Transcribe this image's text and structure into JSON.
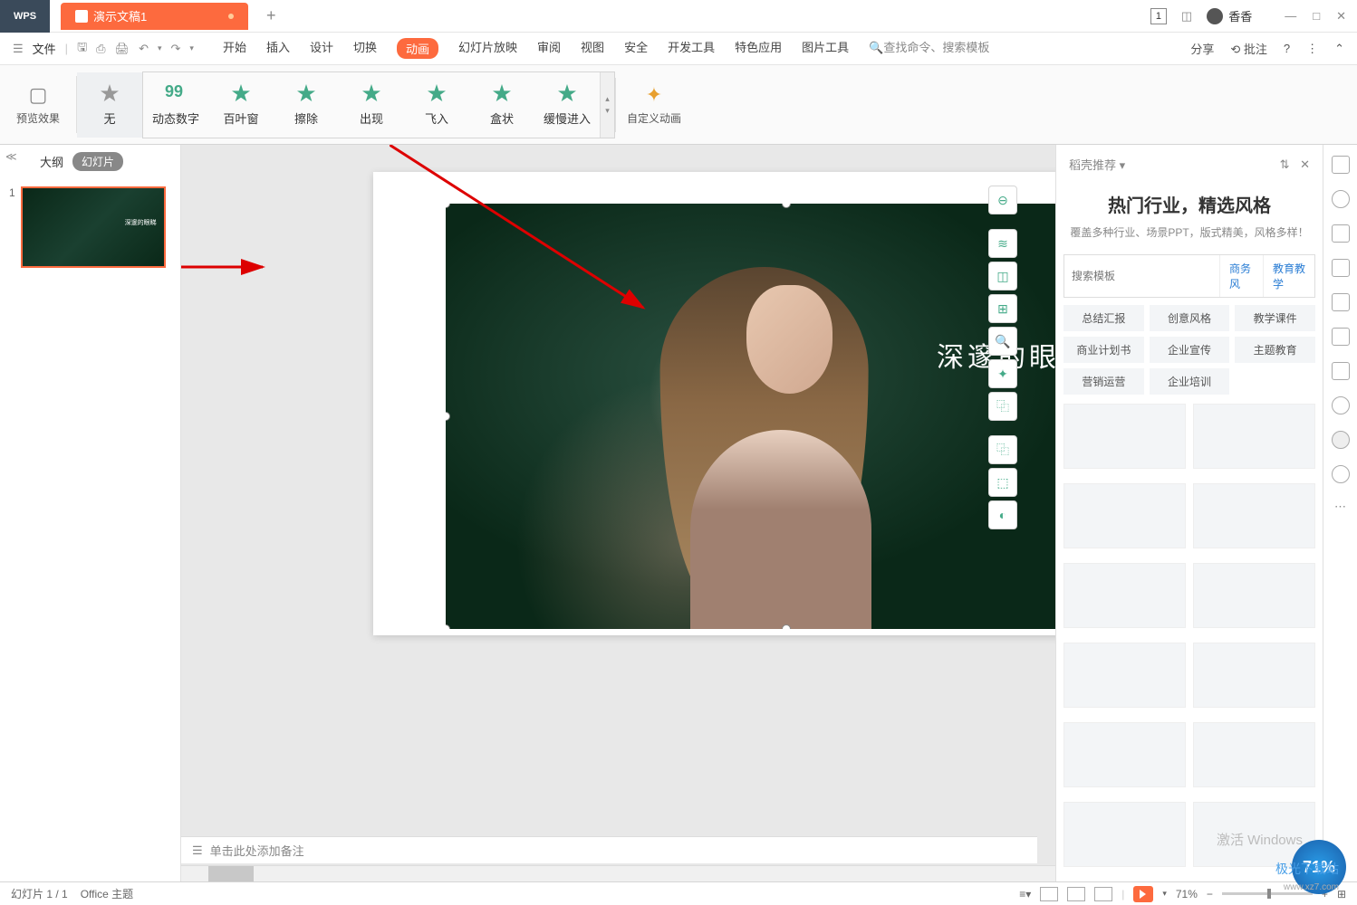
{
  "titlebar": {
    "app": "WPS",
    "tab_name": "演示文稿1",
    "count_box": "1",
    "username": "香香"
  },
  "menu": {
    "file": "文件",
    "tabs": [
      "开始",
      "插入",
      "设计",
      "切换",
      "动画",
      "幻灯片放映",
      "审阅",
      "视图",
      "安全",
      "开发工具",
      "特色应用",
      "图片工具"
    ],
    "search_prompt": "查找命令、搜索模板",
    "share": "分享",
    "batch": "批注"
  },
  "ribbon": {
    "preview": "预览效果",
    "animations": [
      "无",
      "动态数字",
      "百叶窗",
      "擦除",
      "出现",
      "飞入",
      "盒状",
      "缓慢进入"
    ],
    "custom": "自定义动画"
  },
  "thumbs": {
    "outline": "大纲",
    "slides": "幻灯片"
  },
  "slide": {
    "text": "深邃的眼眸"
  },
  "notes": {
    "placeholder": "单击此处添加备注"
  },
  "side": {
    "title": "稻壳推荐",
    "promo_title": "热门行业，精选风格",
    "promo_sub": "覆盖多种行业、场景PPT，版式精美，风格多样！",
    "search_placeholder": "搜索模板",
    "chips": [
      "商务风",
      "教育教学"
    ],
    "tags": [
      "总结汇报",
      "创意风格",
      "教学课件",
      "商业计划书",
      "企业宣传",
      "主题教育",
      "营销运营",
      "企业培训"
    ]
  },
  "status": {
    "slide_info": "幻灯片 1 / 1",
    "theme": "Office 主题",
    "zoom": "71%"
  },
  "activate": "激活 Windows",
  "watermark": {
    "brand": "极光下载站",
    "url": "www.xz7.com"
  },
  "badge": "71%"
}
